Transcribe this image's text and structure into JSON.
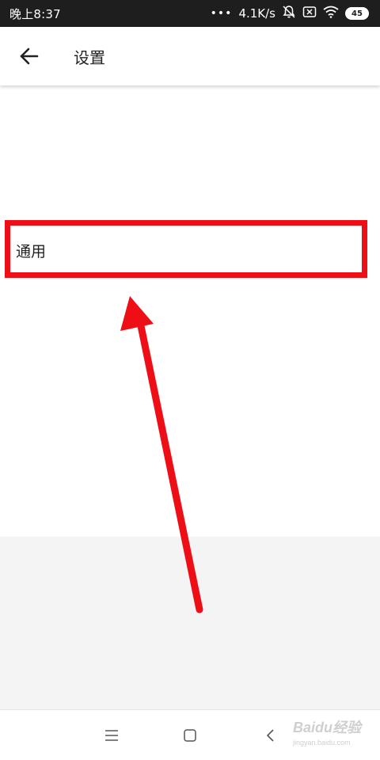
{
  "status_bar": {
    "time": "晚上8:37",
    "more_indicator": "•••",
    "network_speed": "4.1K/s",
    "battery_level": "45",
    "icons": [
      "mute-bell-icon",
      "sim-x-icon",
      "wifi-icon",
      "battery-icon"
    ]
  },
  "app_bar": {
    "title": "设置",
    "back_icon": "arrow-left-icon"
  },
  "settings": {
    "items": [
      {
        "label": "通用"
      }
    ]
  },
  "annotation": {
    "color": "#ee0f16",
    "highlight_target": "通用"
  },
  "nav_bar": {
    "icons": [
      "menu-icon",
      "home-square-icon",
      "back-chevron-icon"
    ]
  },
  "watermark": {
    "brand": "Baidu经验",
    "url": "jingyan.baidu.com"
  }
}
